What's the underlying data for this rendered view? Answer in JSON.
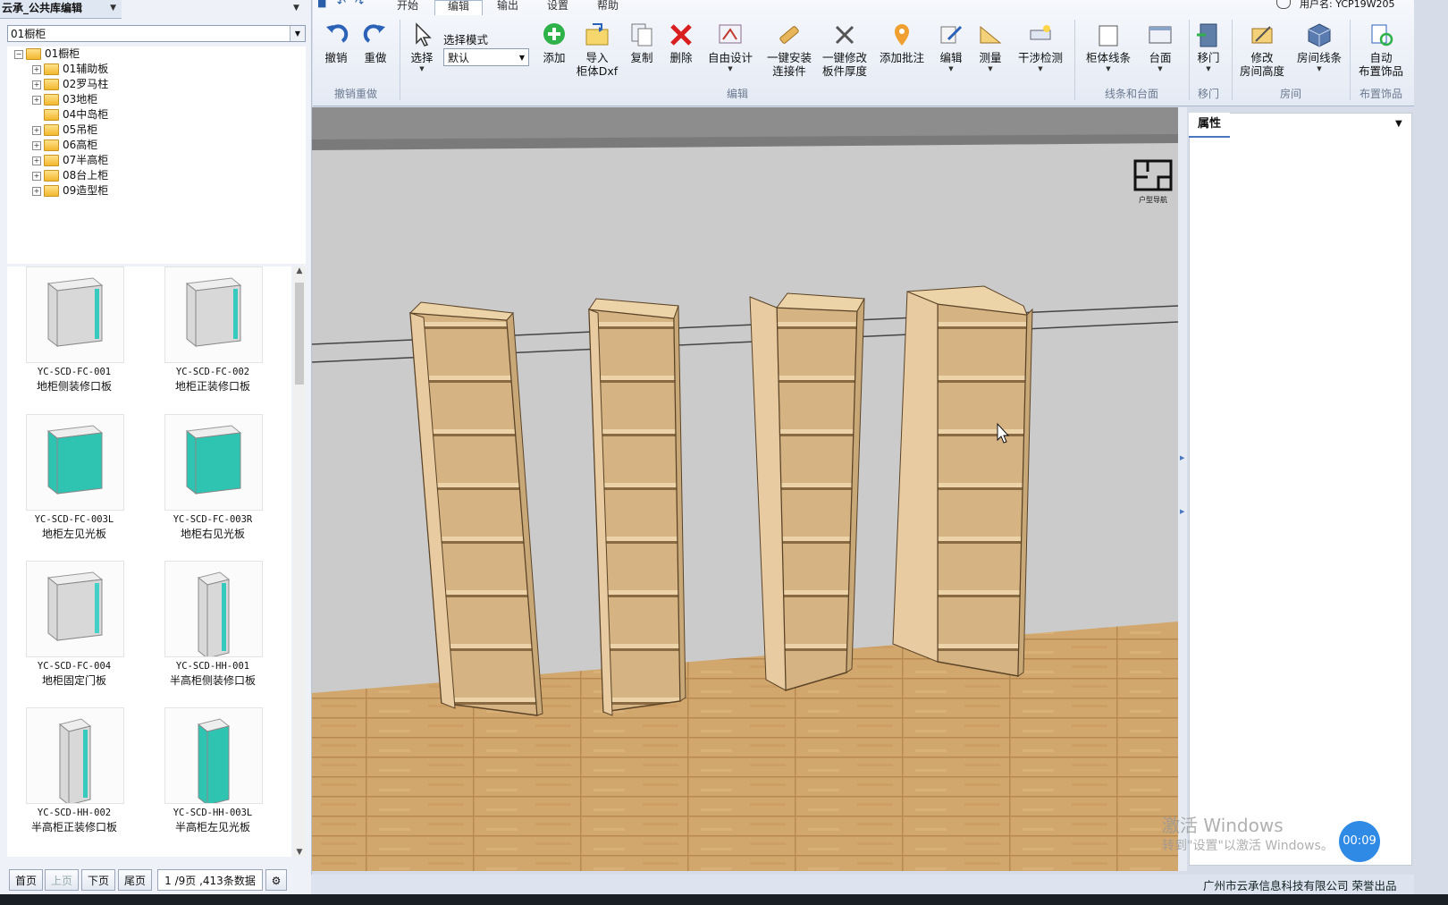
{
  "library": {
    "tab_title": "云承_公共库编辑",
    "category_select": "01橱柜",
    "tree": {
      "root": "01橱柜",
      "children": [
        "01辅助板",
        "02罗马柱",
        "03地柜",
        "04中岛柜",
        "05吊柜",
        "06高柜",
        "07半高柜",
        "08台上柜",
        "09造型柜"
      ]
    },
    "items": [
      {
        "code": "YC-SCD-FC-001",
        "name": "地柜侧装修口板",
        "color": "#d8d8d8",
        "door": "#36c9bd"
      },
      {
        "code": "YC-SCD-FC-002",
        "name": "地柜正装修口板",
        "color": "#d8d8d8",
        "door": "#36c9bd"
      },
      {
        "code": "YC-SCD-FC-003L",
        "name": "地柜左见光板",
        "color": "#2fc4b2",
        "door": "#2fc4b2"
      },
      {
        "code": "YC-SCD-FC-003R",
        "name": "地柜右见光板",
        "color": "#2fc4b2",
        "door": "#2fc4b2"
      },
      {
        "code": "YC-SCD-FC-004",
        "name": "地柜固定门板",
        "color": "#d8d8d8",
        "door": "#44d0c6"
      },
      {
        "code": "YC-SCD-HH-001",
        "name": "半高柜侧装修口板",
        "color": "#d8d8d8",
        "door": "#36c9bd"
      },
      {
        "code": "YC-SCD-HH-002",
        "name": "半高柜正装修口板",
        "color": "#d8d8d8",
        "door": "#36c9bd"
      },
      {
        "code": "YC-SCD-HH-003L",
        "name": "半高柜左见光板",
        "color": "#2fc4b2",
        "door": "#2fc4b2"
      }
    ],
    "pager": {
      "first": "首页",
      "prev": "上页",
      "next": "下页",
      "last": "尾页",
      "info": "1 /9页 ,413条数据"
    }
  },
  "ribbon": {
    "tabs": [
      "开始",
      "编辑",
      "输出",
      "设置",
      "帮助"
    ],
    "active_tab": "编辑",
    "user": "用户名: YCP19W205",
    "mode_label": "选择模式",
    "mode_value": "默认",
    "buttons": {
      "undo": "撤销",
      "redo": "重做",
      "select": "选择",
      "add": "添加",
      "import_l1": "导入",
      "import_l2": "柜体Dxf",
      "copy": "复制",
      "delete": "删除",
      "free_design": "自由设计",
      "install_l1": "一键安装",
      "install_l2": "连接件",
      "thick_l1": "一键修改",
      "thick_l2": "板件厚度",
      "annotate": "添加批注",
      "edit": "编辑",
      "measure": "测量",
      "interference": "干涉检测",
      "cab_lines": "柜体线条",
      "counter": "台面",
      "move_door": "移门",
      "room_h_l1": "修改",
      "room_h_l2": "房间高度",
      "room_lines": "房间线条",
      "auto_l1": "自动",
      "auto_l2": "布置饰品"
    },
    "groups": {
      "undo_redo": "撤销重做",
      "edit": "编辑",
      "lines_counter": "线条和台面",
      "move_door": "移门",
      "room": "房间",
      "decor": "布置饰品"
    }
  },
  "viewport": {
    "nav_label": "户型导航"
  },
  "properties": {
    "tab": "属性"
  },
  "overlay": {
    "watermark_title": "激活 Windows",
    "watermark_sub": "转到\"设置\"以激活 Windows。",
    "timer": "00:09"
  },
  "status": {
    "company": "广州市云承信息科技有限公司 荣誉出品"
  },
  "colors": {
    "accent": "#4a78c0",
    "wood": "#e8cba0",
    "floor": "#d2a76e",
    "wall": "#cbcbcb"
  }
}
